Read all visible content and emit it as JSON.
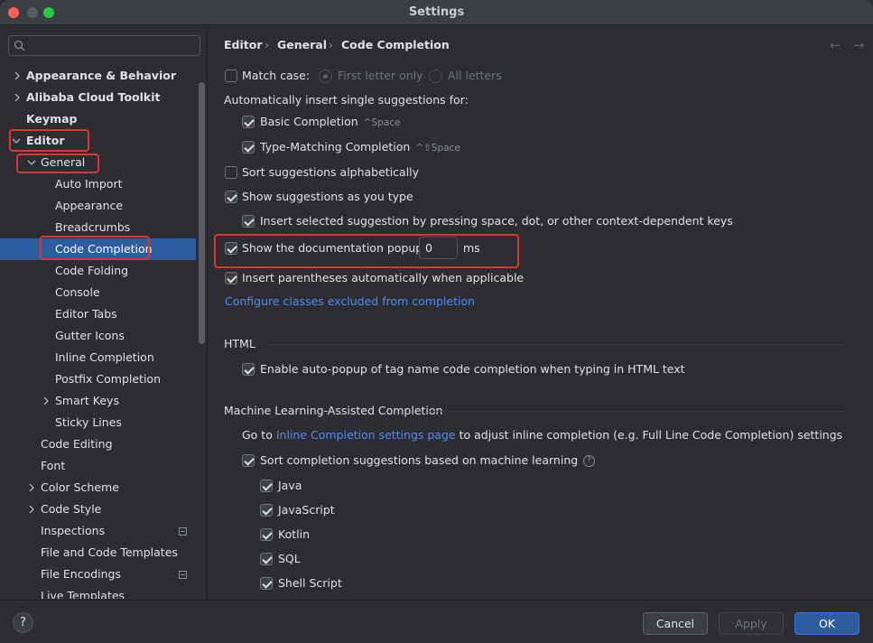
{
  "window": {
    "title": "Settings"
  },
  "sidebar": {
    "search_placeholder": "",
    "items": [
      {
        "label": "Appearance & Behavior"
      },
      {
        "label": "Alibaba Cloud Toolkit"
      },
      {
        "label": "Keymap"
      },
      {
        "label": "Editor"
      },
      {
        "label": "General"
      },
      {
        "label": "Auto Import"
      },
      {
        "label": "Appearance"
      },
      {
        "label": "Breadcrumbs"
      },
      {
        "label": "Code Completion"
      },
      {
        "label": "Code Folding"
      },
      {
        "label": "Console"
      },
      {
        "label": "Editor Tabs"
      },
      {
        "label": "Gutter Icons"
      },
      {
        "label": "Inline Completion"
      },
      {
        "label": "Postfix Completion"
      },
      {
        "label": "Smart Keys"
      },
      {
        "label": "Sticky Lines"
      },
      {
        "label": "Code Editing"
      },
      {
        "label": "Font"
      },
      {
        "label": "Color Scheme"
      },
      {
        "label": "Code Style"
      },
      {
        "label": "Inspections"
      },
      {
        "label": "File and Code Templates"
      },
      {
        "label": "File Encodings"
      },
      {
        "label": "Live Templates"
      }
    ]
  },
  "breadcrumb": {
    "parts": [
      "Editor",
      "General",
      "Code Completion"
    ],
    "separator": "›"
  },
  "nav": {
    "back": "←",
    "forward": "→"
  },
  "options": {
    "match_case": "Match case:",
    "first_letter_only": "First letter only",
    "all_letters": "All letters",
    "auto_insert_heading": "Automatically insert single suggestions for:",
    "basic_completion": "Basic Completion",
    "basic_shortcut": "^Space",
    "type_matching": "Type-Matching Completion",
    "type_matching_shortcut": "^⇧Space",
    "sort_alpha": "Sort suggestions alphabetically",
    "show_as_type": "Show suggestions as you type",
    "insert_selected": "Insert selected suggestion by pressing space, dot, or other context-dependent keys",
    "show_doc_popup": "Show the documentation popup in",
    "doc_popup_value": "0",
    "doc_popup_unit": "ms",
    "insert_parens": "Insert parentheses automatically when applicable",
    "configure_link": "Configure classes excluded from completion"
  },
  "html_section": {
    "title": "HTML",
    "auto_popup": "Enable auto-popup of tag name code completion when typing in HTML text"
  },
  "ml_section": {
    "title": "Machine Learning-Assisted Completion",
    "goto_prefix": "Go to",
    "goto_link": "Inline Completion settings page",
    "goto_suffix": "to adjust inline completion (e.g. Full Line Code Completion) settings",
    "sort_ml": "Sort completion suggestions based on machine learning",
    "help": "?",
    "languages": [
      "Java",
      "JavaScript",
      "Kotlin",
      "SQL",
      "Shell Script"
    ]
  },
  "footer": {
    "help": "?",
    "cancel": "Cancel",
    "apply": "Apply",
    "ok": "OK"
  },
  "colors": {
    "accent": "#2e5d9f",
    "link": "#548af7",
    "highlight_box": "#e0352b"
  }
}
